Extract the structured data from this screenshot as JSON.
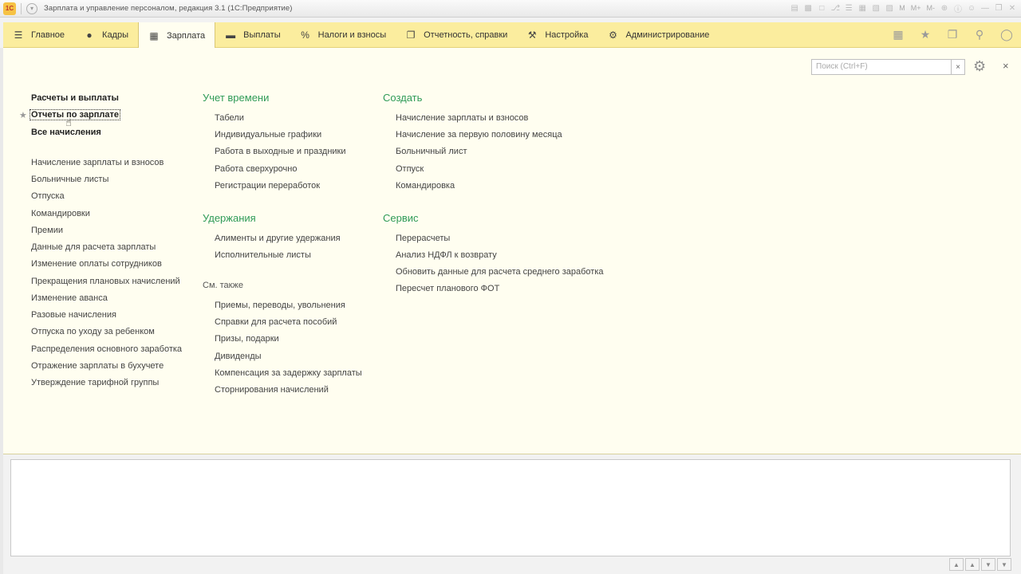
{
  "window": {
    "title": "Зарплата и управление персоналом, редакция 3.1  (1С:Предприятие)",
    "logo": "1С",
    "tools": [
      "save-icon",
      "print-icon",
      "preview-icon",
      "attach-icon",
      "list-icon",
      "calendar-icon",
      "table-icon",
      "calc-icon"
    ],
    "mem_labels": [
      "M",
      "M+",
      "M-"
    ]
  },
  "sections": [
    {
      "label": "Главное",
      "icon": "menu-icon"
    },
    {
      "label": "Кадры",
      "icon": "people-icon"
    },
    {
      "label": "Зарплата",
      "icon": "calculator-icon"
    },
    {
      "label": "Выплаты",
      "icon": "wallet-icon"
    },
    {
      "label": "Налоги и взносы",
      "icon": "percent-icon"
    },
    {
      "label": "Отчетность, справки",
      "icon": "documents-icon"
    },
    {
      "label": "Настройка",
      "icon": "wrench-icon"
    },
    {
      "label": "Администрирование",
      "icon": "gear-icon"
    }
  ],
  "active_section": "Зарплата",
  "search": {
    "placeholder": "Поиск (Ctrl+F)",
    "clear": "×"
  },
  "close_label": "×",
  "left_column": {
    "top_items": [
      "Расчеты и выплаты",
      "Отчеты по зарплате",
      "Все начисления"
    ],
    "items": [
      "Начисление зарплаты и взносов",
      "Больничные листы",
      "Отпуска",
      "Командировки",
      "Премии",
      "Данные для расчета зарплаты",
      "Изменение оплаты сотрудников",
      "Прекращения плановых начислений",
      "Изменение аванса",
      "Разовые начисления",
      "Отпуска по уходу за ребенком",
      "Распределения основного заработка",
      "Отражение зарплаты в бухучете",
      "Утверждение тарифной группы"
    ]
  },
  "groups": {
    "time": {
      "title": "Учет времени",
      "items": [
        "Табели",
        "Индивидуальные графики",
        "Работа в выходные и праздники",
        "Работа сверхурочно",
        "Регистрации переработок"
      ]
    },
    "deductions": {
      "title": "Удержания",
      "items": [
        "Алименты и другие удержания",
        "Исполнительные листы"
      ]
    },
    "see_also": {
      "title": "См. также",
      "items": [
        "Приемы, переводы, увольнения",
        "Справки для расчета пособий",
        "Призы, подарки",
        "Дивиденды",
        "Компенсация за задержку зарплаты",
        "Сторнирования начислений"
      ]
    },
    "create": {
      "title": "Создать",
      "items": [
        "Начисление зарплаты и взносов",
        "Начисление за первую половину месяца",
        "Больничный лист",
        "Отпуск",
        "Командировка"
      ]
    },
    "service": {
      "title": "Сервис",
      "items": [
        "Перерасчеты",
        "Анализ НДФЛ к возврату",
        "Обновить данные для расчета среднего заработка",
        "Пересчет планового ФОТ"
      ]
    }
  },
  "colors": {
    "section_bar": "#fbed9e",
    "panel_bg": "#fffef0",
    "group_heading": "#2f9b58"
  }
}
